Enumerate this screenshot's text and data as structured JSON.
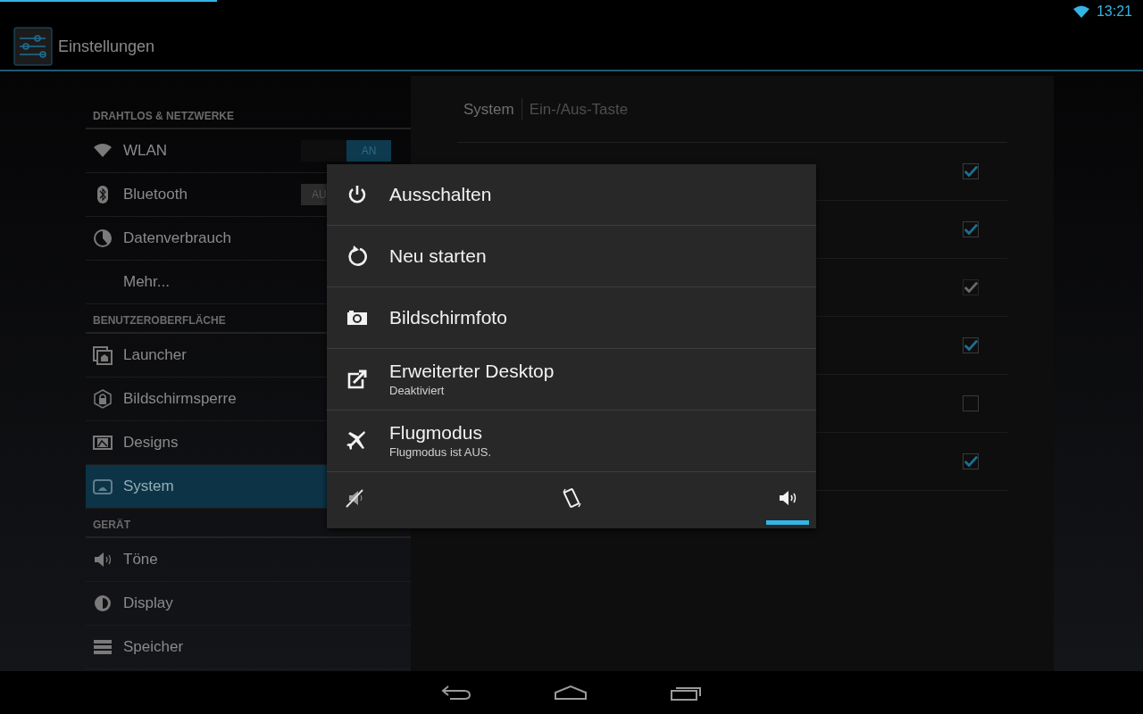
{
  "status_bar": {
    "time": "13:21"
  },
  "action_bar": {
    "title": "Einstellungen"
  },
  "sidebar": {
    "sections": [
      {
        "header": "DRAHTLOS & NETZWERKE",
        "items": [
          {
            "label": "WLAN",
            "kind": "wifi",
            "selected": false,
            "toggle": {
              "text": "AN",
              "on": true
            }
          },
          {
            "label": "Bluetooth",
            "kind": "bluetooth",
            "selected": false,
            "toggle": {
              "text": "AU",
              "on": false
            }
          },
          {
            "label": "Datenverbrauch",
            "kind": "data",
            "selected": false
          },
          {
            "label": "Mehr...",
            "selected": false
          }
        ]
      },
      {
        "header": "BENUTZEROBERFLÄCHE",
        "items": [
          {
            "label": "Launcher",
            "kind": "launcher",
            "selected": false
          },
          {
            "label": "Bildschirmsperre",
            "kind": "lock",
            "selected": false
          },
          {
            "label": "Designs",
            "kind": "designs",
            "selected": false
          },
          {
            "label": "System",
            "kind": "system",
            "selected": true
          }
        ]
      },
      {
        "header": "GERÄT",
        "items": [
          {
            "label": "Töne",
            "kind": "sound",
            "selected": false
          },
          {
            "label": "Display",
            "kind": "display",
            "selected": false
          },
          {
            "label": "Speicher",
            "kind": "storage",
            "selected": false
          }
        ]
      }
    ]
  },
  "detail": {
    "breadcrumb": [
      {
        "label": "System",
        "active": true
      },
      {
        "label": "Ein-/Aus-Taste",
        "active": false
      }
    ],
    "rows": [
      {
        "checked": true,
        "disabled": false
      },
      {
        "checked": true,
        "disabled": false
      },
      {
        "checked": true,
        "disabled": true
      },
      {
        "checked": true,
        "disabled": false
      },
      {
        "checked": false,
        "disabled": false
      },
      {
        "checked": true,
        "disabled": false
      }
    ]
  },
  "power_menu": {
    "items": [
      {
        "label": "Ausschalten",
        "kind": "power"
      },
      {
        "label": "Neu starten",
        "kind": "restart"
      },
      {
        "label": "Bildschirmfoto",
        "kind": "camera"
      },
      {
        "label": "Erweiterter Desktop",
        "summary": "Deaktiviert",
        "kind": "external"
      },
      {
        "label": "Flugmodus",
        "summary": "Flugmodus ist AUS.",
        "kind": "airplane"
      }
    ],
    "sound_modes": [
      {
        "kind": "silent",
        "selected": false
      },
      {
        "kind": "vibrate",
        "selected": false
      },
      {
        "kind": "sound",
        "selected": true
      }
    ]
  }
}
